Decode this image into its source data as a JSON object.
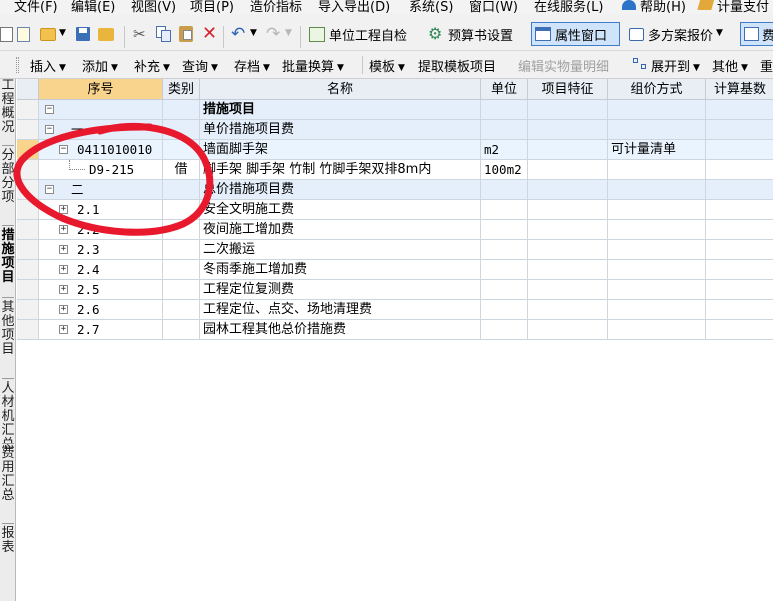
{
  "menu": [
    "文件(F)",
    "编辑(E)",
    "视图(V)",
    "项目(P)",
    "造价指标",
    "导入导出(D)",
    "系统(S)",
    "窗口(W)",
    "在线服务(L)",
    "帮助(H)",
    "计量支付"
  ],
  "toolbar1": {
    "self_check": "单位工程自检",
    "budget_settings": "预算书设置",
    "property_window": "属性窗口",
    "multi_scheme": "多方案报价",
    "fee": "费"
  },
  "toolbar2": {
    "insert": "插入",
    "add": "添加",
    "supplement": "补充",
    "query": "查询",
    "archive": "存档",
    "batch_replace": "批量换算",
    "template": "模板",
    "extract_template": "提取模板项目",
    "edit_detail": "编辑实物量明细",
    "expand_to": "展开到",
    "other": "其他",
    "more": "重"
  },
  "left_tabs": [
    "工程概况",
    "分部分项",
    "措施项目",
    "其他项目",
    "人材机汇总",
    "费用汇总",
    "报表"
  ],
  "columns": [
    "序号",
    "类别",
    "名称",
    "单位",
    "项目特征",
    "组价方式",
    "计算基数"
  ],
  "rows": [
    {
      "seq": "",
      "type": "",
      "name": "措施项目",
      "unit": "",
      "feature": "",
      "method": "",
      "base": "",
      "toggle": "−",
      "level": 0
    },
    {
      "seq": "一",
      "type": "",
      "name": "单价措施项目费",
      "unit": "",
      "feature": "",
      "method": "",
      "base": "",
      "toggle": "−",
      "level": 1
    },
    {
      "seq": "0411010010",
      "type": "",
      "name": "墙面脚手架",
      "unit": "m2",
      "feature": "",
      "method": "可计量清单",
      "base": "",
      "toggle": "−",
      "level": 2
    },
    {
      "seq": "D9-215",
      "type": "借",
      "name": "脚手架 脚手架 竹制 竹脚手架双排8m内",
      "unit": "100m2",
      "feature": "",
      "method": "",
      "base": "",
      "toggle": "",
      "level": 3
    },
    {
      "seq": "二",
      "type": "",
      "name": "总价措施项目费",
      "unit": "",
      "feature": "",
      "method": "",
      "base": "",
      "toggle": "−",
      "level": 1
    },
    {
      "seq": "2.1",
      "type": "",
      "name": "安全文明施工费",
      "unit": "",
      "feature": "",
      "method": "",
      "base": "",
      "toggle": "+",
      "level": 2
    },
    {
      "seq": "2.2",
      "type": "",
      "name": "夜间施工增加费",
      "unit": "",
      "feature": "",
      "method": "",
      "base": "",
      "toggle": "+",
      "level": 2
    },
    {
      "seq": "2.3",
      "type": "",
      "name": "二次搬运",
      "unit": "",
      "feature": "",
      "method": "",
      "base": "",
      "toggle": "+",
      "level": 2
    },
    {
      "seq": "2.4",
      "type": "",
      "name": "冬雨季施工增加费",
      "unit": "",
      "feature": "",
      "method": "",
      "base": "",
      "toggle": "+",
      "level": 2
    },
    {
      "seq": "2.5",
      "type": "",
      "name": "工程定位复测费",
      "unit": "",
      "feature": "",
      "method": "",
      "base": "",
      "toggle": "+",
      "level": 2
    },
    {
      "seq": "2.6",
      "type": "",
      "name": "工程定位、点交、场地清理费",
      "unit": "",
      "feature": "",
      "method": "",
      "base": "",
      "toggle": "+",
      "level": 2
    },
    {
      "seq": "2.7",
      "type": "",
      "name": "园林工程其他总价措施费",
      "unit": "",
      "feature": "",
      "method": "",
      "base": "",
      "toggle": "+",
      "level": 2
    }
  ],
  "colors": {
    "header_bg": "#e9eef5",
    "seq_header_bg": "#f8d48d",
    "group_row_bg": "#e4effb",
    "selected_row_bg": "#fff7dc",
    "annotation": "#e8192c"
  }
}
